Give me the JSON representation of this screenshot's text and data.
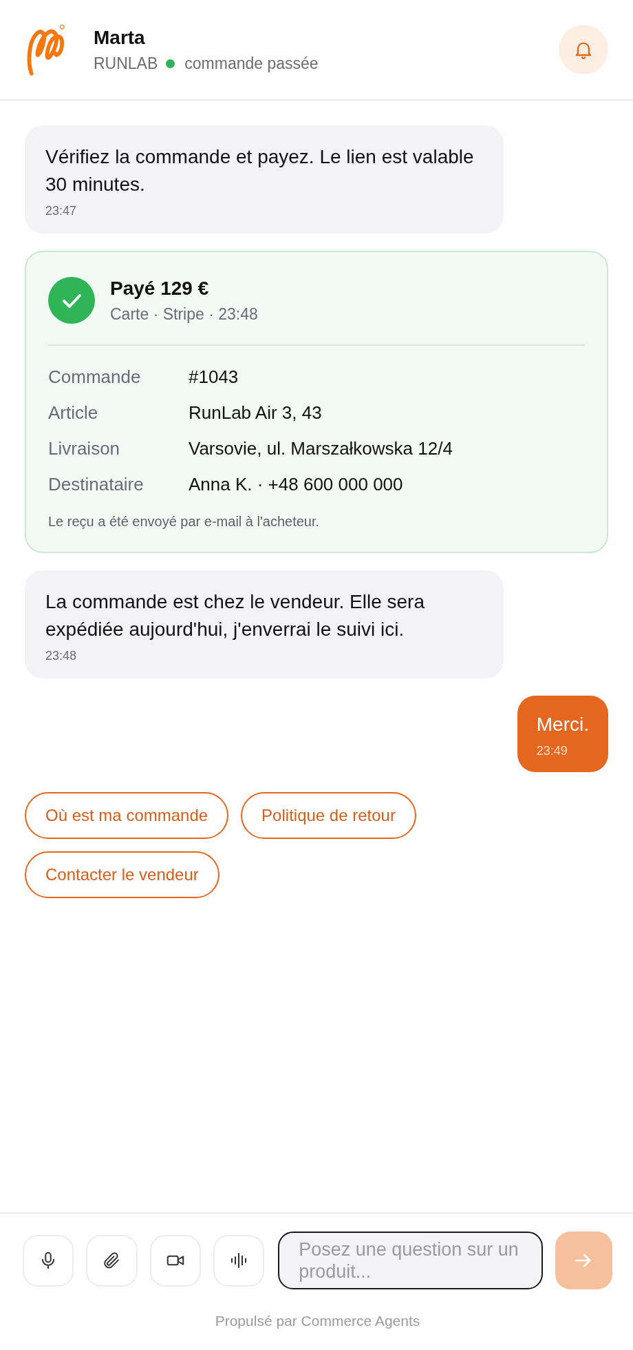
{
  "header": {
    "name": "Marta",
    "brand": "RUNLAB",
    "status": "commande passée"
  },
  "messages": [
    {
      "kind": "agent",
      "text": "Vérifiez la commande et payez. Le lien est valable 30 minutes.",
      "time": "23:47"
    },
    {
      "kind": "payment",
      "title": "Payé 129 €",
      "subtitle": "Carte · Stripe · 23:48",
      "rows": [
        {
          "label": "Commande",
          "value": "#1043"
        },
        {
          "label": "Article",
          "value": "RunLab Air 3, 43"
        },
        {
          "label": "Livraison",
          "value": "Varsovie, ul. Marszałkowska 12/4"
        },
        {
          "label": "Destinataire",
          "value": "Anna K. · +48 600 000 000"
        }
      ],
      "note": "Le reçu a été envoyé par e-mail à l'acheteur."
    },
    {
      "kind": "agent",
      "text": "La commande est chez le vendeur. Elle sera expédiée aujourd'hui, j'enverrai le suivi ici.",
      "time": "23:48"
    },
    {
      "kind": "user",
      "text": "Merci.",
      "time": "23:49"
    }
  ],
  "quick_replies": [
    "Où est ma commande",
    "Politique de retour",
    "Contacter le vendeur"
  ],
  "composer": {
    "tools": [
      {
        "kind": "mic"
      },
      {
        "kind": "attach"
      },
      {
        "kind": "video"
      },
      {
        "kind": "voice"
      }
    ],
    "placeholder": "Posez une question sur un produit...",
    "send_disabled": true
  },
  "footer": "Propulsé par Commerce Agents"
}
